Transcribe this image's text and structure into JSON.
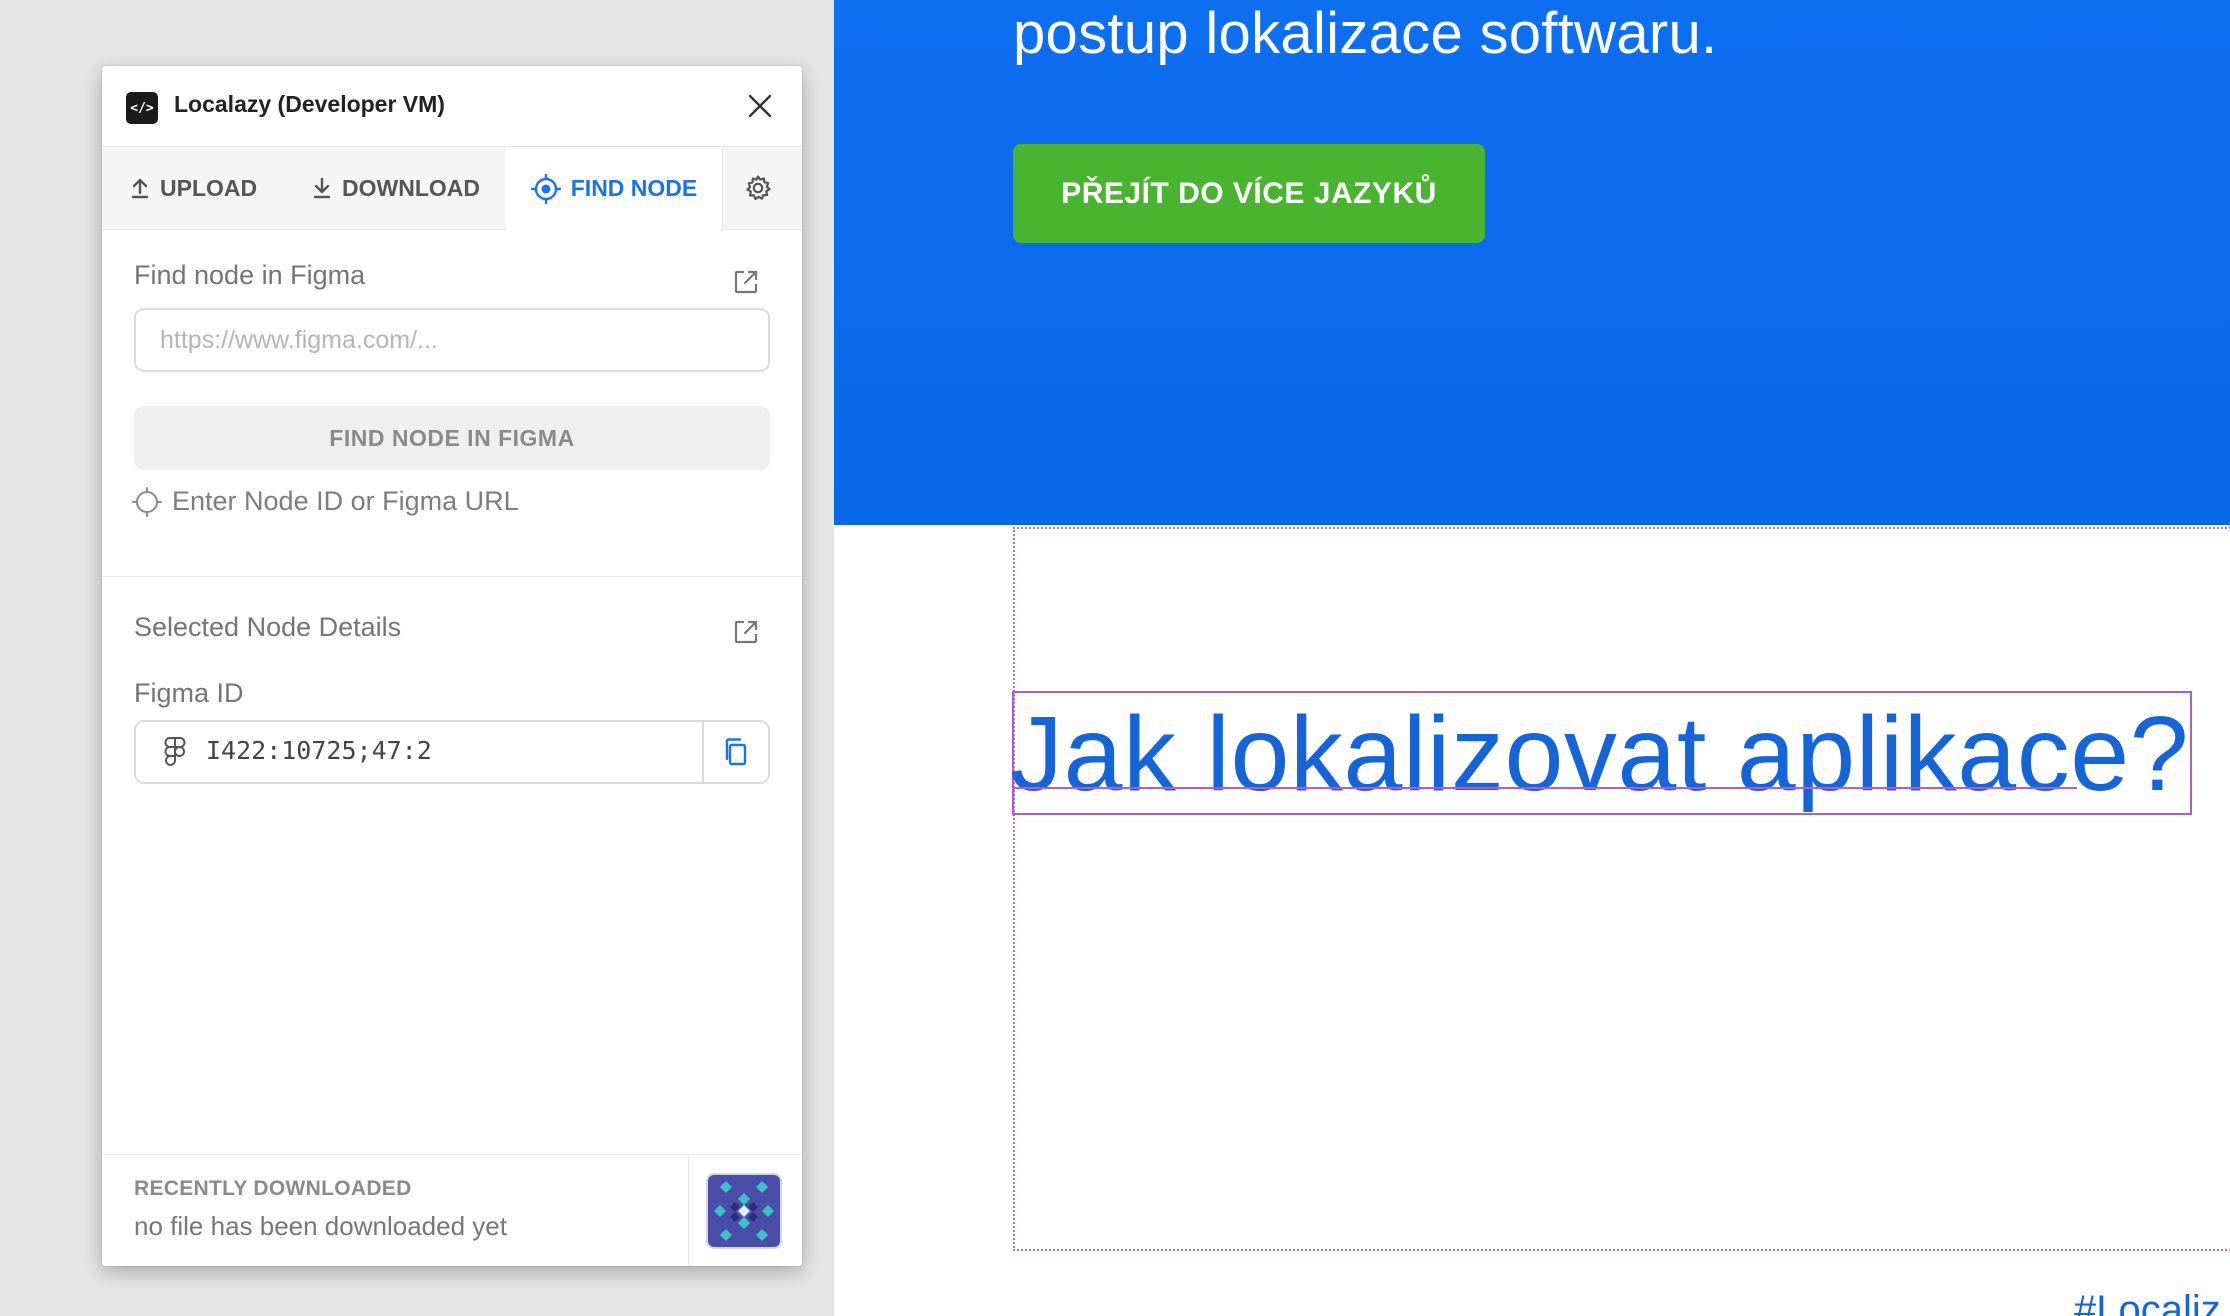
{
  "plugin": {
    "title": "Localazy (Developer VM)",
    "app_icon_glyph": "</>",
    "tabs": {
      "upload": "UPLOAD",
      "download": "DOWNLOAD",
      "find_node": "FIND NODE"
    },
    "active_tab": "find_node",
    "find_section": {
      "label": "Find node in Figma",
      "input_placeholder": "https://www.figma.com/...",
      "input_value": "",
      "button_label": "FIND NODE IN FIGMA",
      "hint": "Enter Node ID or Figma URL"
    },
    "details_section": {
      "label": "Selected Node Details",
      "figma_id_label": "Figma ID",
      "figma_id_value": "I422:10725;47:2"
    },
    "footer": {
      "title": "RECENTLY DOWNLOADED",
      "text": "no file has been downloaded yet"
    },
    "accent_color": "#1a73e8"
  },
  "canvas": {
    "hero_text": "postup lokalizace softwaru.",
    "cta_label": "PŘEJÍT DO VÍCE JAZYKŮ",
    "heading": "Jak lokalizovat aplikace?",
    "bottom_tag": "#Localiz",
    "hero_color": "#0a6ced",
    "cta_color": "#48b42f",
    "selection_color": "#b05ad8"
  }
}
